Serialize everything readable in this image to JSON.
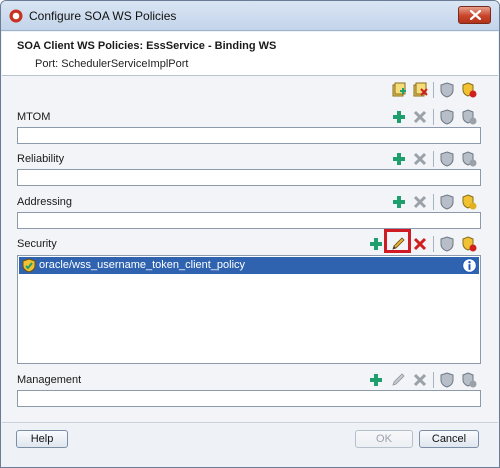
{
  "window": {
    "title": "Configure SOA WS Policies"
  },
  "header": {
    "title": "SOA Client WS Policies: EssService - Binding WS",
    "port": "Port: SchedulerServiceImplPort"
  },
  "sections": {
    "mtom": {
      "label": "MTOM"
    },
    "reliability": {
      "label": "Reliability"
    },
    "addressing": {
      "label": "Addressing"
    },
    "security": {
      "label": "Security",
      "policies": [
        "oracle/wss_username_token_client_policy"
      ]
    },
    "management": {
      "label": "Management"
    }
  },
  "buttons": {
    "help": "Help",
    "ok": "OK",
    "cancel": "Cancel"
  },
  "colors": {
    "add": "#1f9e6e",
    "remove_active": "#d0201d",
    "selection": "#2f63b0",
    "highlight": "#d01b24"
  }
}
